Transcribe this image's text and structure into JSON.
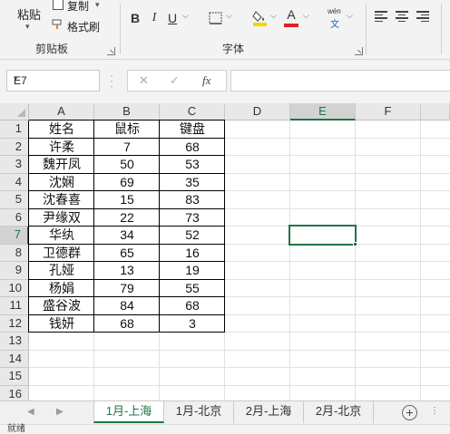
{
  "ribbon": {
    "clipboard": {
      "paste": "粘贴",
      "copy": "复制",
      "format_painter": "格式刷",
      "label": "剪贴板"
    },
    "font": {
      "bold": "B",
      "italic": "I",
      "underline": "U",
      "font_color": "A",
      "wen": "wén",
      "wen_char": "文",
      "label": "字体",
      "highlight_color": "#f7d300",
      "font_color_bar": "#e02020"
    }
  },
  "formula_bar": {
    "name_box": "E7",
    "cancel": "✕",
    "enter": "✓",
    "fx": "fx",
    "formula": ""
  },
  "columns": [
    "A",
    "B",
    "C",
    "D",
    "E",
    "F"
  ],
  "rows": [
    "1",
    "2",
    "3",
    "4",
    "5",
    "6",
    "7",
    "8",
    "9",
    "10",
    "11",
    "12",
    "13",
    "14",
    "15",
    "16"
  ],
  "selected_cell": "E7",
  "table": {
    "headers": [
      "姓名",
      "鼠标",
      "键盘"
    ],
    "rows": [
      [
        "许柔",
        "7",
        "68"
      ],
      [
        "魏开凤",
        "50",
        "53"
      ],
      [
        "沈娴",
        "69",
        "35"
      ],
      [
        "沈春喜",
        "15",
        "83"
      ],
      [
        "尹缘双",
        "22",
        "73"
      ],
      [
        "华纨",
        "34",
        "52"
      ],
      [
        "卫德群",
        "65",
        "16"
      ],
      [
        "孔娅",
        "13",
        "19"
      ],
      [
        "杨娟",
        "79",
        "55"
      ],
      [
        "盛谷波",
        "84",
        "68"
      ],
      [
        "钱妍",
        "68",
        "3"
      ]
    ]
  },
  "sheets": [
    "1月-上海",
    "1月-北京",
    "2月-上海",
    "2月-北京"
  ],
  "active_sheet": "1月-上海",
  "add_sheet": "+",
  "status": "就绪",
  "accent_color": "#217346"
}
